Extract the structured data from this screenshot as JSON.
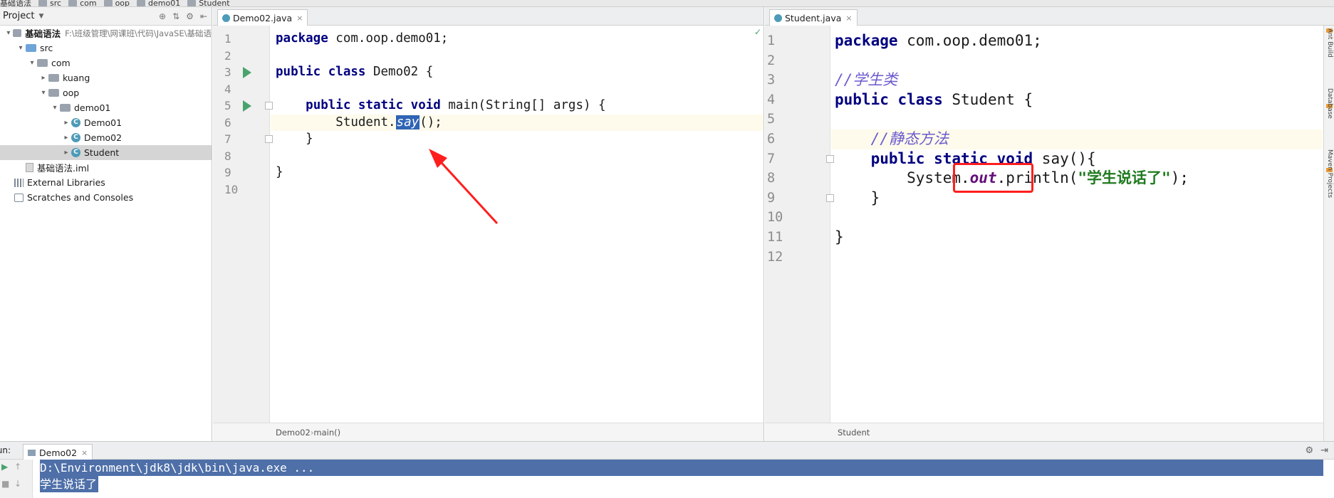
{
  "topbar": {
    "crumbs": [
      "基础语法",
      "src",
      "com",
      "oop",
      "demo01",
      "Student"
    ]
  },
  "project_panel": {
    "title": "Project",
    "tree": [
      {
        "label": "基础语法",
        "path": "F:\\班级管理\\网课班\\代码\\JavaSE\\基础语",
        "icon": "folder-icon",
        "depth": 0,
        "arrow": "▾"
      },
      {
        "label": "src",
        "icon": "folder-icon",
        "depth": 1,
        "arrow": "▾"
      },
      {
        "label": "com",
        "icon": "folder-icon",
        "depth": 2,
        "arrow": "▾"
      },
      {
        "label": "kuang",
        "icon": "folder-icon",
        "depth": 3,
        "arrow": "▸"
      },
      {
        "label": "oop",
        "icon": "folder-icon",
        "depth": 3,
        "arrow": "▾"
      },
      {
        "label": "demo01",
        "icon": "folder-icon",
        "depth": 4,
        "arrow": "▾"
      },
      {
        "label": "Demo01",
        "icon": "class-icon",
        "depth": 5,
        "arrow": "▸"
      },
      {
        "label": "Demo02",
        "icon": "class-icon",
        "depth": 5,
        "arrow": "▸"
      },
      {
        "label": "Student",
        "icon": "class-icon",
        "depth": 5,
        "arrow": "▸",
        "selected": true
      },
      {
        "label": "基础语法.iml",
        "icon": "file-icon",
        "depth": 1,
        "arrow": ""
      },
      {
        "label": "External Libraries",
        "icon": "library-icon",
        "depth": 0,
        "arrow": ""
      },
      {
        "label": "Scratches and Consoles",
        "icon": "scratch-icon",
        "depth": 0,
        "arrow": ""
      }
    ]
  },
  "left_editor": {
    "tab_label": "Demo02.java",
    "line_numbers": [
      "1",
      "2",
      "3",
      "4",
      "5",
      "6",
      "7",
      "8",
      "9",
      "10"
    ],
    "lines": [
      [
        {
          "t": "package ",
          "c": "kw"
        },
        {
          "t": "com.oop.demo01;",
          "c": ""
        }
      ],
      [],
      [
        {
          "t": "public class ",
          "c": "kw"
        },
        {
          "t": "Demo02 {",
          "c": ""
        }
      ],
      [],
      [
        {
          "t": "    "
        },
        {
          "t": "public static void ",
          "c": "kw"
        },
        {
          "t": "main(String[] args) {",
          "c": ""
        }
      ],
      [
        {
          "t": "        Student.",
          "c": ""
        },
        {
          "t": "say",
          "c": "say-sel"
        },
        {
          "t": "();",
          "c": ""
        }
      ],
      [
        {
          "t": "    }",
          "c": ""
        }
      ],
      [],
      [
        {
          "t": "}",
          "c": ""
        }
      ],
      []
    ],
    "breadcrumb": [
      "Demo02",
      "main()"
    ]
  },
  "right_editor": {
    "tab_label": "Student.java",
    "line_numbers": [
      "1",
      "2",
      "3",
      "4",
      "5",
      "6",
      "7",
      "8",
      "9",
      "10",
      "11",
      "12"
    ],
    "lines": [
      [
        {
          "t": "package ",
          "c": "kw"
        },
        {
          "t": "com.oop.demo01;",
          "c": ""
        }
      ],
      [],
      [
        {
          "t": "//学生类",
          "c": "cm"
        }
      ],
      [
        {
          "t": "public class ",
          "c": "kw"
        },
        {
          "t": "Student {",
          "c": ""
        }
      ],
      [],
      [
        {
          "t": "    "
        },
        {
          "t": "//静态方法",
          "c": "cm"
        }
      ],
      [
        {
          "t": "    "
        },
        {
          "t": "public static void ",
          "c": "kw"
        },
        {
          "t": "say(){",
          "c": ""
        }
      ],
      [
        {
          "t": "        System.",
          "c": ""
        },
        {
          "t": "out",
          "c": "fld"
        },
        {
          "t": ".println(",
          "c": ""
        },
        {
          "t": "\"学生说话了\"",
          "c": "st"
        },
        {
          "t": ");",
          "c": ""
        }
      ],
      [
        {
          "t": "    }",
          "c": ""
        }
      ],
      [],
      [
        {
          "t": "}",
          "c": ""
        }
      ],
      []
    ],
    "breadcrumb": [
      "Student"
    ]
  },
  "right_tool_strip": [
    "Ant Build",
    "Database",
    "Maven Projects"
  ],
  "run_panel": {
    "label": "Run:",
    "tab_label": "Demo02",
    "output": [
      "D:\\Environment\\jdk8\\jdk\\bin\\java.exe ...",
      "学生说话了"
    ]
  }
}
